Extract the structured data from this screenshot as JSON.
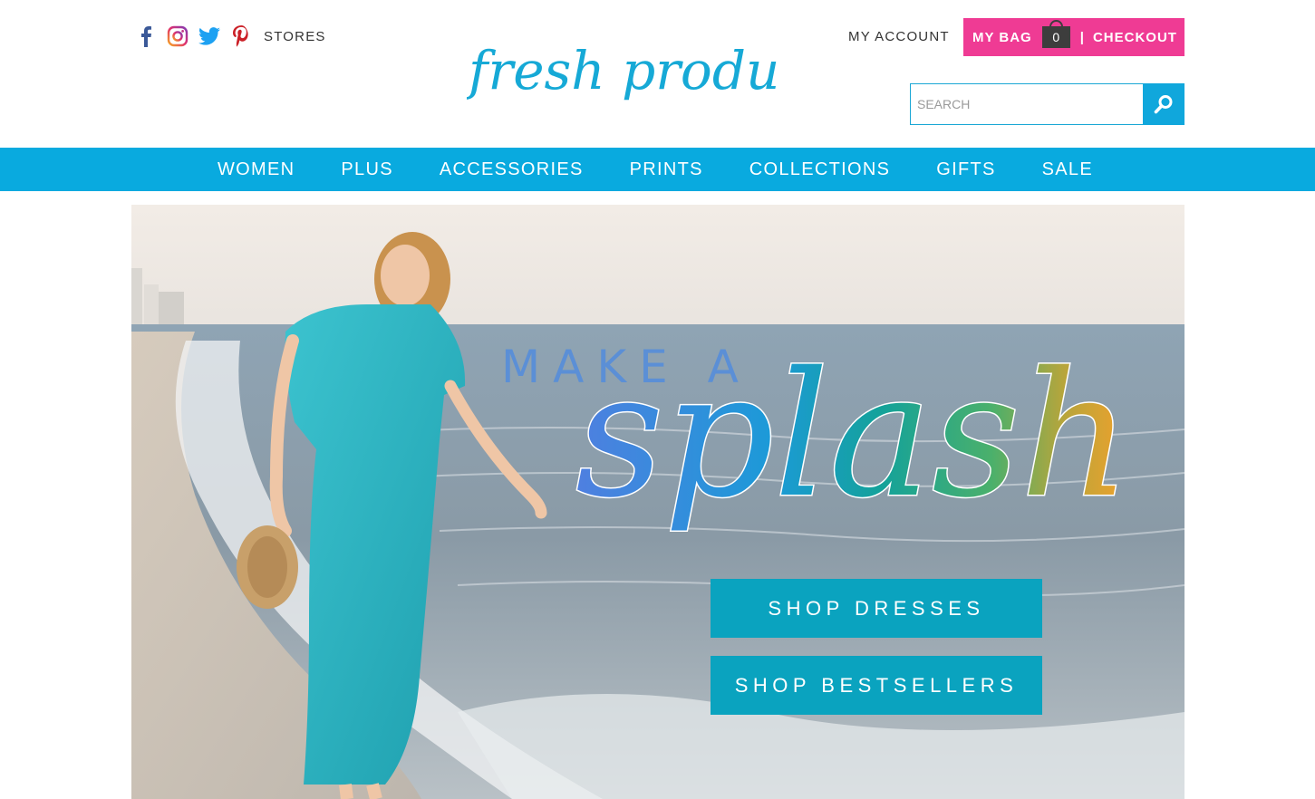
{
  "header": {
    "social_icons": [
      "facebook-icon",
      "instagram-icon",
      "twitter-icon",
      "pinterest-icon"
    ],
    "stores_label": "STORES",
    "logo_text": "fresh produce",
    "my_account_label": "MY ACCOUNT",
    "bag": {
      "label": "MY BAG",
      "count": "0",
      "separator": "|",
      "checkout_label": "CHECKOUT"
    },
    "search": {
      "placeholder": "SEARCH",
      "value": "",
      "icon": "search-icon"
    }
  },
  "nav": {
    "items": [
      "WOMEN",
      "PLUS",
      "ACCESSORIES",
      "PRINTS",
      "COLLECTIONS",
      "GIFTS",
      "SALE"
    ]
  },
  "hero": {
    "headline_top": "MAKE A",
    "headline_script": "splash",
    "buttons": [
      "SHOP DRESSES",
      "SHOP BESTSELLERS"
    ]
  },
  "colors": {
    "brand_blue": "#09aadf",
    "bag_pink": "#ef3b94",
    "cta_teal": "#0aa3bf",
    "dress_turquoise": "#2fb7c4"
  }
}
